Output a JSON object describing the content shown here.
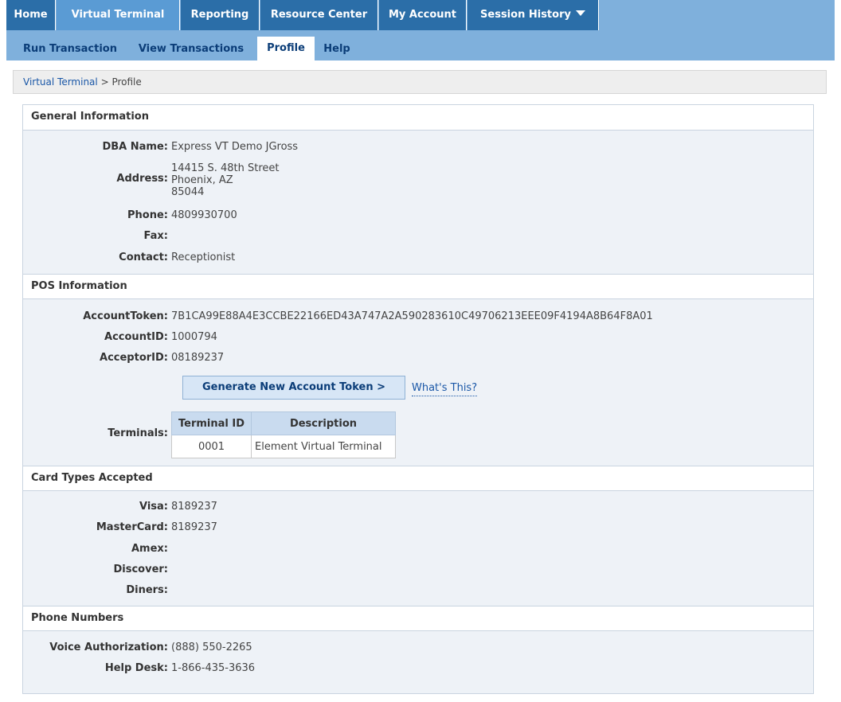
{
  "nav": {
    "tabs": [
      "Home",
      "Virtual Terminal",
      "Reporting",
      "Resource Center",
      "My Account",
      "Session History"
    ],
    "active_index": 1
  },
  "subnav": {
    "items": [
      "Run Transaction",
      "View Transactions",
      "Profile",
      "Help"
    ],
    "active_index": 2
  },
  "breadcrumb": {
    "link": "Virtual Terminal",
    "separator": " > ",
    "current": "Profile"
  },
  "general": {
    "title": "General Information",
    "dba_label": "DBA Name:",
    "dba_value": "Express VT Demo JGross",
    "address_label": "Address:",
    "address_lines": [
      "14415 S. 48th Street",
      "Phoenix, AZ",
      "85044"
    ],
    "phone_label": "Phone:",
    "phone_value": "4809930700",
    "fax_label": "Fax:",
    "fax_value": "",
    "contact_label": "Contact:",
    "contact_value": "Receptionist"
  },
  "pos": {
    "title": "POS Information",
    "token_label": "AccountToken:",
    "token_value": "7B1CA99E88A4E3CCBE22166ED43A747A2A590283610C49706213EEE09F4194A8B64F8A01",
    "account_id_label": "AccountID:",
    "account_id_value": "1000794",
    "acceptor_id_label": "AcceptorID:",
    "acceptor_id_value": "08189237",
    "generate_button": "Generate New Account Token >",
    "whats_this": "What's This?",
    "terminals_label": "Terminals:",
    "terminal_headers": [
      "Terminal ID",
      "Description"
    ],
    "terminals": [
      {
        "id": "0001",
        "description": "Element Virtual Terminal"
      }
    ]
  },
  "cards": {
    "title": "Card Types Accepted",
    "visa_label": "Visa:",
    "visa_value": "8189237",
    "mc_label": "MasterCard:",
    "mc_value": "8189237",
    "amex_label": "Amex:",
    "amex_value": "",
    "discover_label": "Discover:",
    "discover_value": "",
    "diners_label": "Diners:",
    "diners_value": ""
  },
  "phones": {
    "title": "Phone Numbers",
    "voice_label": "Voice Authorization:",
    "voice_value": "(888) 550-2265",
    "help_label": "Help Desk:",
    "help_value": "1-866-435-3636"
  }
}
